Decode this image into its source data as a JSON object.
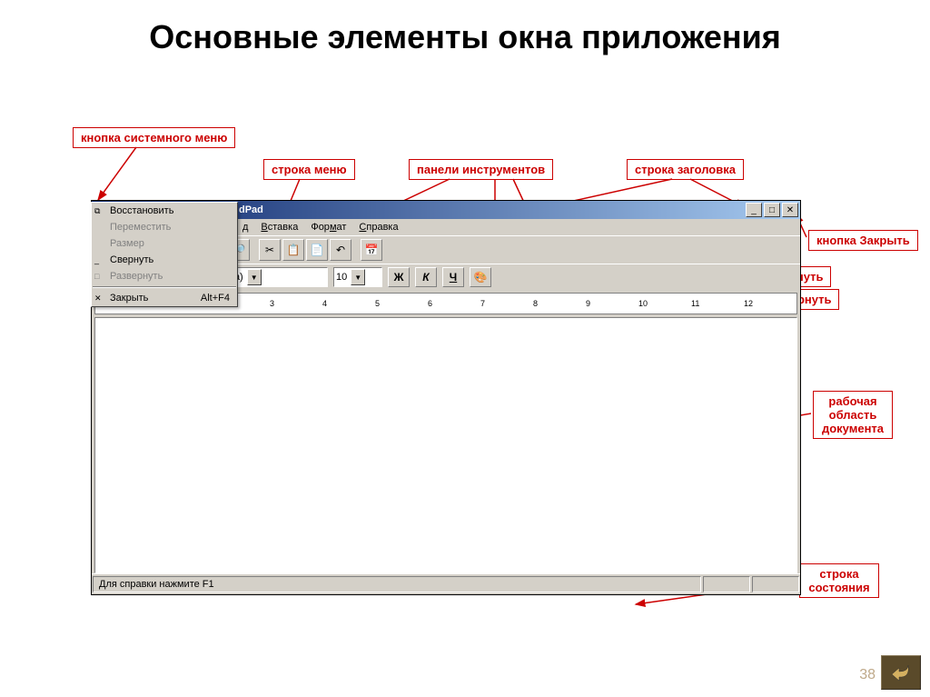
{
  "title": "Основные элементы окна приложения",
  "callouts": {
    "sysmenu_btn": "кнопка системного меню",
    "menubar": "строка меню",
    "toolbars": "панели инструментов",
    "titlebar": "строка заголовка",
    "close_btn": "кнопка Закрыть",
    "maximize_btn": "кнопка Развернуть",
    "minimize_btn": "кнопка Свернуть",
    "workarea": "рабочая область документа",
    "statusbar": "строка состояния"
  },
  "titlebar_text": "dPad",
  "menubar": [
    "д",
    "Вставка",
    "Формат",
    "Справка"
  ],
  "sysmenu": {
    "restore": "Восстановить",
    "move": "Переместить",
    "size": "Размер",
    "minimize": "Свернуть",
    "maximize": "Развернуть",
    "close": "Закрыть",
    "close_shortcut": "Alt+F4"
  },
  "format": {
    "font": "Times New Roman (Кириллица)",
    "size": "10",
    "bold": "Ж",
    "italic": "К",
    "underline": "Ч"
  },
  "statusbar_text": "Для справки нажмите F1",
  "slide_number": "38"
}
